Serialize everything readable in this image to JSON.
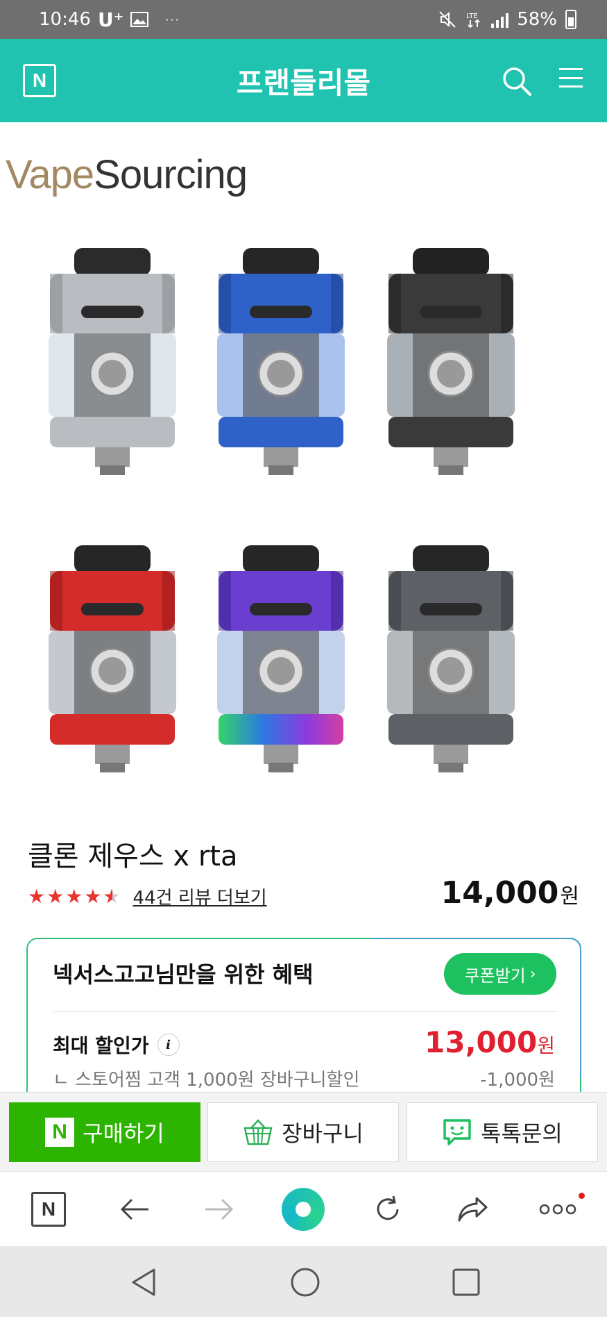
{
  "status_bar": {
    "time": "10:46",
    "carrier": "U⁺",
    "battery_percent": "58%",
    "icons": [
      "image-icon",
      "mute-icon",
      "lte-icon",
      "signal-icon",
      "battery-icon"
    ]
  },
  "header": {
    "title": "프랜들리몰",
    "logo": "N"
  },
  "brand": {
    "part1": "Vape",
    "part2": "Sourcing"
  },
  "product_images": [
    {
      "color": "silver"
    },
    {
      "color": "blue"
    },
    {
      "color": "black"
    },
    {
      "color": "red"
    },
    {
      "color": "rainbow"
    },
    {
      "color": "gunmetal"
    }
  ],
  "product": {
    "title": "클론 제우스 x rta",
    "rating": 4.5,
    "review_link": "44건 리뷰 더보기",
    "price": "14,000",
    "currency": "원"
  },
  "benefit": {
    "title": "넥서스고고님만을 위한 혜택",
    "coupon_button": "쿠폰받기",
    "max_discount_label": "최대 할인가",
    "max_discount_price": "13,000",
    "currency": "원",
    "discount_row_label": "ㄴ 스토어찜 고객 1,000원 장바구니할인",
    "discount_row_amount": "-1,000원"
  },
  "actions": {
    "buy": "구매하기",
    "cart": "장바구니",
    "talk": "톡톡문의"
  },
  "colors": {
    "header": "#20c3b0",
    "buy": "#2db400",
    "coupon": "#1ec160",
    "price_red": "#e02030",
    "star": "#e8342f"
  }
}
